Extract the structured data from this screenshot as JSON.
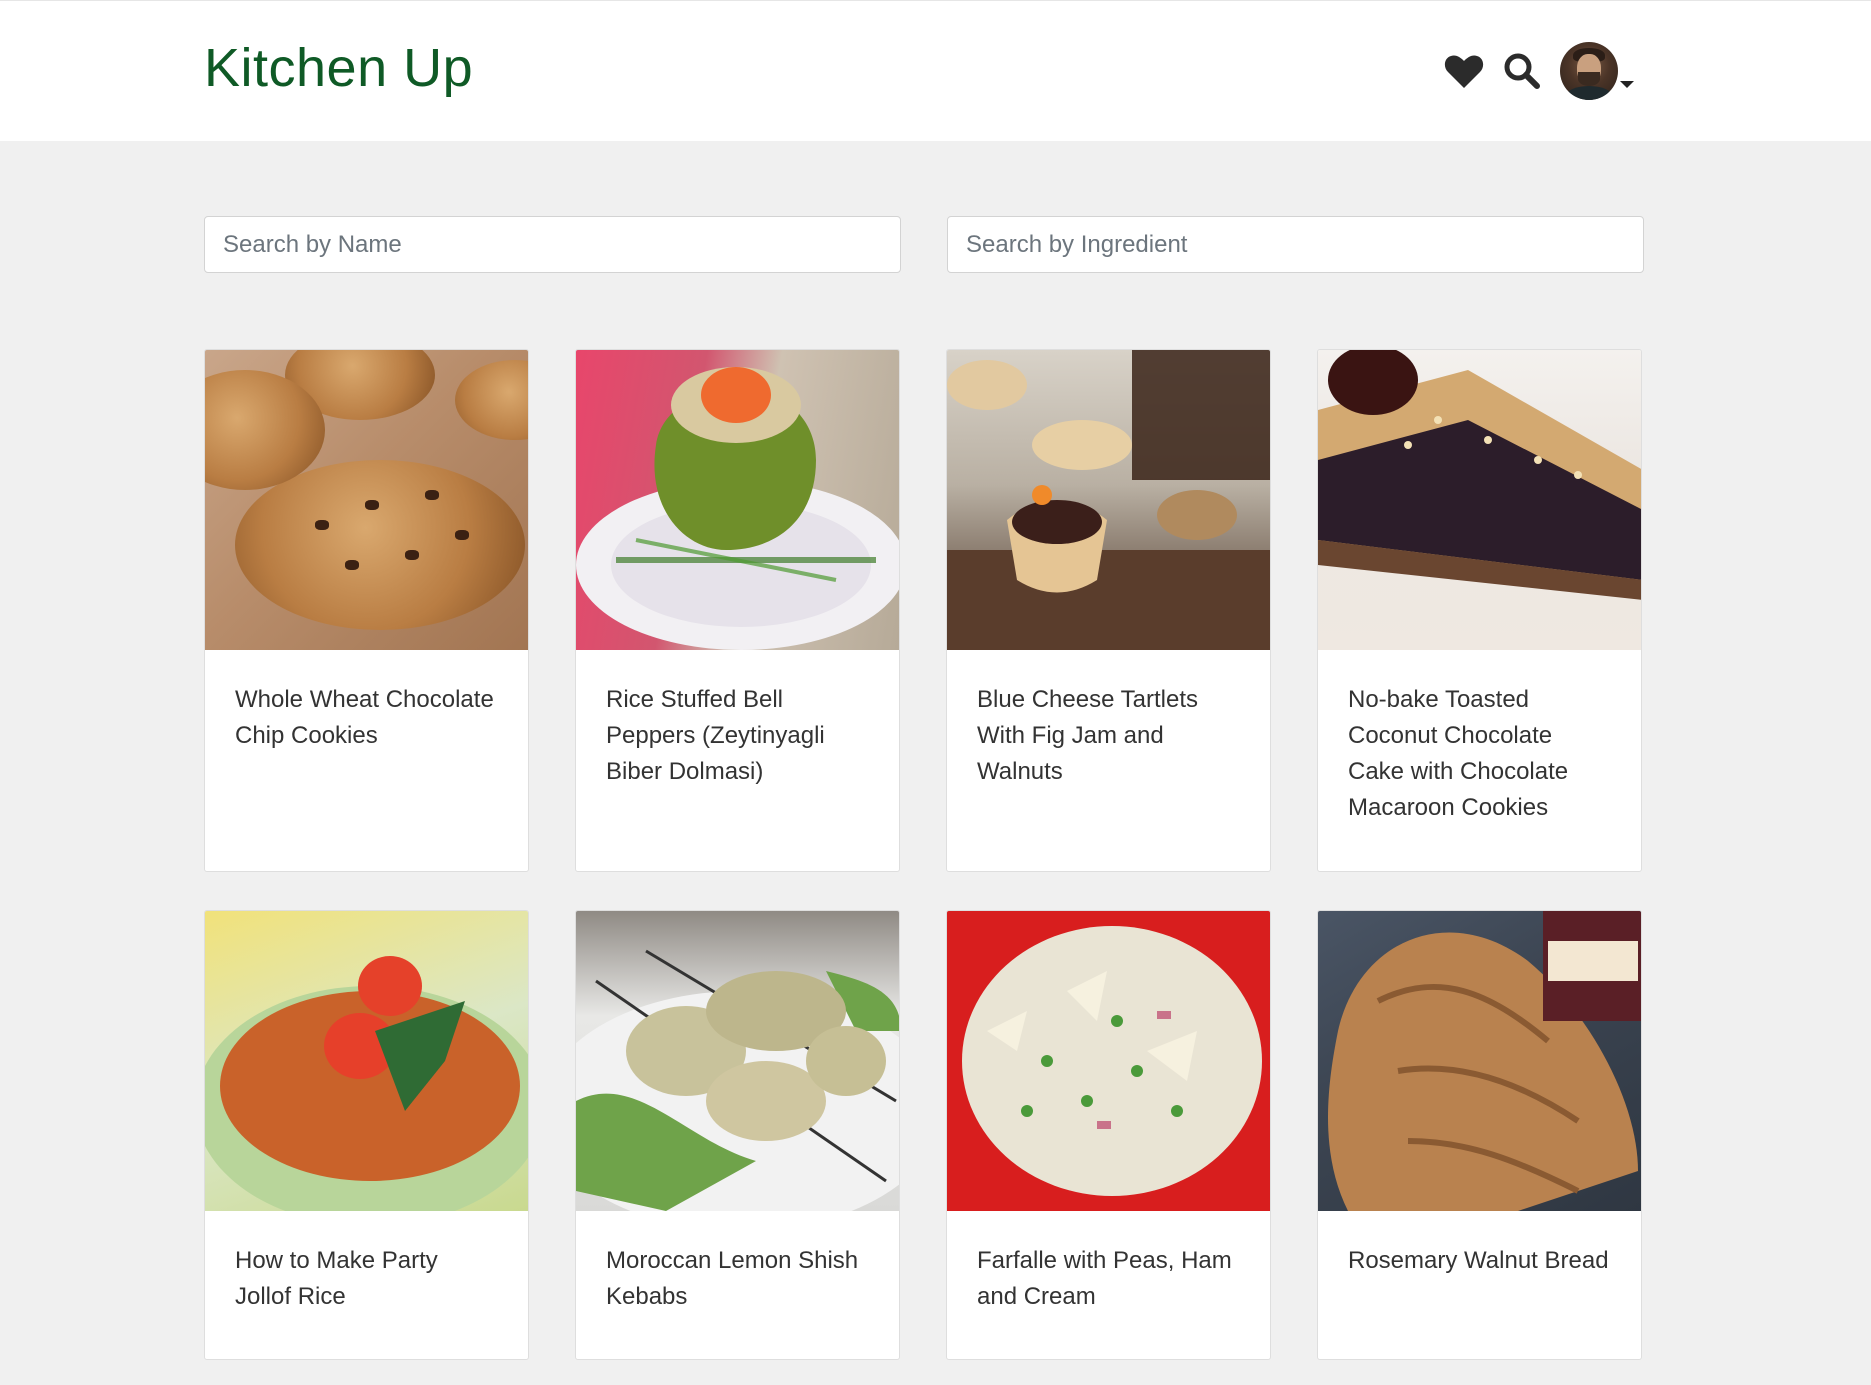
{
  "app": {
    "title": "Kitchen Up"
  },
  "header": {
    "icons": [
      "heart-icon",
      "search-icon",
      "avatar",
      "caret-down-icon"
    ]
  },
  "search": {
    "name_placeholder": "Search by Name",
    "ingredient_placeholder": "Search by Ingredient"
  },
  "recipes": [
    {
      "title": "Whole Wheat Chocolate Chip Cookies"
    },
    {
      "title": "Rice Stuffed Bell Peppers (Zeytinyagli Biber Dolmasi)"
    },
    {
      "title": "Blue Cheese Tartlets With Fig Jam and Walnuts"
    },
    {
      "title": "No-bake Toasted Coconut Chocolate Cake with Chocolate Macaroon Cookies"
    },
    {
      "title": "How to Make Party Jollof Rice"
    },
    {
      "title": "Moroccan Lemon Shish Kebabs"
    },
    {
      "title": "Farfalle with Peas, Ham and Cream"
    },
    {
      "title": "Rosemary Walnut Bread"
    }
  ],
  "colors": {
    "brand": "#0f5a26",
    "page_background": "#f0f0f0",
    "header_background": "#ffffff"
  }
}
